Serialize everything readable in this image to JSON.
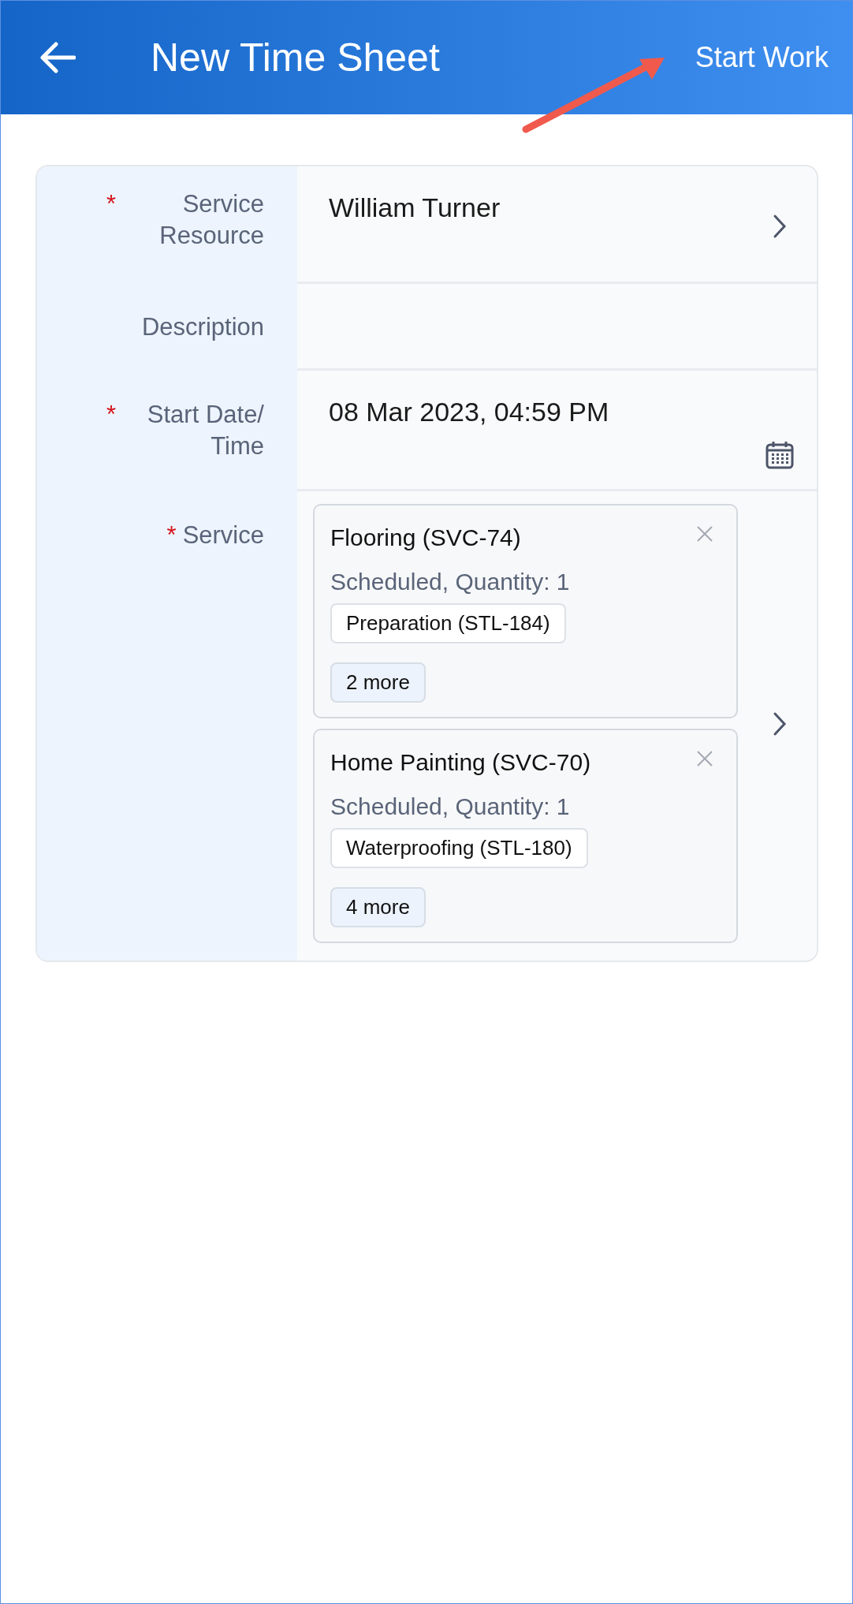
{
  "header": {
    "title": "New Time Sheet",
    "action": "Start Work"
  },
  "annotation": {
    "kind": "arrow"
  },
  "fields": [
    {
      "label": "Service Resource",
      "marker": "*",
      "kind": "picker",
      "value": "William Turner"
    },
    {
      "label": "Description",
      "kind": "text"
    },
    {
      "label": "Start Date/ Time",
      "marker": "*",
      "kind": "date",
      "value": "08 Mar 2023, 04:59 PM"
    },
    {
      "label": "Service",
      "marker": "*",
      "kind": "services",
      "services": [
        {
          "name": "Flooring (SVC-74)",
          "status": "Scheduled, Quantity: 1",
          "tag": "Preparation (STL-184)",
          "more": "2 more"
        },
        {
          "name": "Home Painting (SVC-70)",
          "status": "Scheduled, Quantity: 1",
          "tag": "Waterproofing (STL-180)",
          "more": "4 more"
        }
      ]
    }
  ]
}
